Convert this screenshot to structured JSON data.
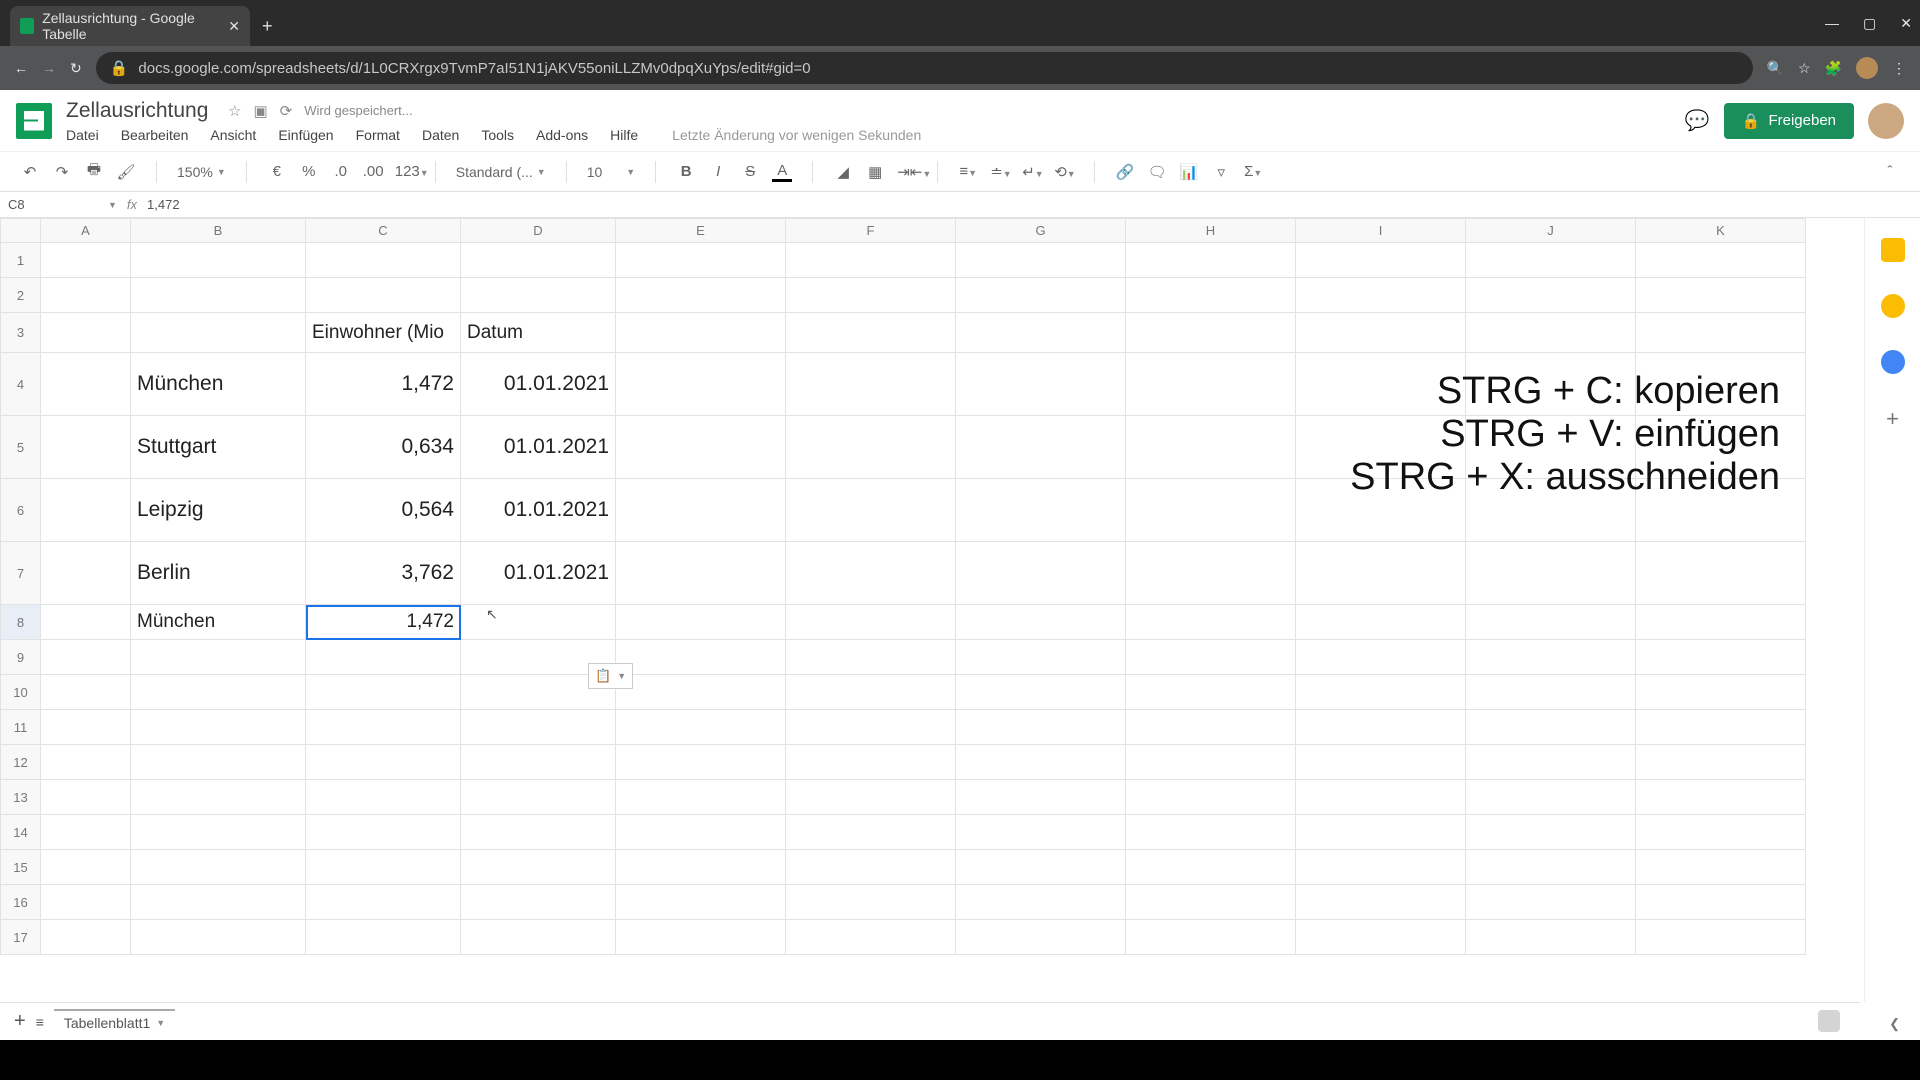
{
  "browser": {
    "tab_title": "Zellausrichtung - Google Tabelle",
    "url": "docs.google.com/spreadsheets/d/1L0CRXrgx9TvmP7aI51N1jAKV55oniLLZMv0dpqXuYps/edit#gid=0"
  },
  "doc": {
    "title": "Zellausrichtung",
    "saving": "Wird gespeichert...",
    "last_edit": "Letzte Änderung vor wenigen Sekunden"
  },
  "menu": {
    "datei": "Datei",
    "bearbeiten": "Bearbeiten",
    "ansicht": "Ansicht",
    "einfuegen": "Einfügen",
    "format": "Format",
    "daten": "Daten",
    "tools": "Tools",
    "addons": "Add-ons",
    "hilfe": "Hilfe"
  },
  "toolbar": {
    "zoom": "150%",
    "font": "Standard (...",
    "size": "10"
  },
  "share_label": "Freigeben",
  "name_box": "C8",
  "formula_value": "1,472",
  "columns": [
    "A",
    "B",
    "C",
    "D",
    "E",
    "F",
    "G",
    "H",
    "I",
    "J",
    "K"
  ],
  "headers": {
    "c3": "Einwohner (Mio",
    "d3": "Datum"
  },
  "rows": [
    {
      "b": "München",
      "c": "1,472",
      "d": "01.01.2021"
    },
    {
      "b": "Stuttgart",
      "c": "0,634",
      "d": "01.01.2021"
    },
    {
      "b": "Leipzig",
      "c": "0,564",
      "d": "01.01.2021"
    },
    {
      "b": "Berlin",
      "c": "3,762",
      "d": "01.01.2021"
    }
  ],
  "row8": {
    "b": "München",
    "c": "1,472"
  },
  "overlay": {
    "l1": "STRG + C: kopieren",
    "l2": "STRG + V: einfügen",
    "l3": "STRG + X: ausschneiden"
  },
  "sheet_tab": "Tabellenblatt1"
}
